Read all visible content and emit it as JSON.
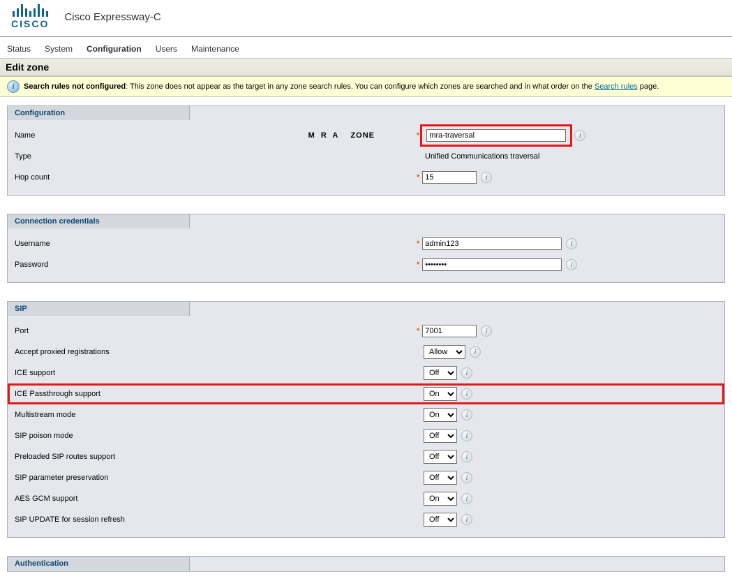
{
  "product": "Cisco Expressway-C",
  "tabs": {
    "status": "Status",
    "system": "System",
    "configuration": "Configuration",
    "users": "Users",
    "maintenance": "Maintenance"
  },
  "page_title": "Edit zone",
  "notify": {
    "strong": "Search rules not configured",
    "text": ": This zone does not appear as the target in any zone search rules. You can configure which zones are searched and in what order on the ",
    "link": "Search rules",
    "tail": " page."
  },
  "section": {
    "configuration": "Configuration",
    "connection": "Connection credentials",
    "sip": "SIP",
    "auth": "Authentication"
  },
  "decor": {
    "mra": "M R A",
    "zone": "ZONE"
  },
  "cfg": {
    "name_label": "Name",
    "name_value": "mra-traversal",
    "type_label": "Type",
    "type_value": "Unified Communications traversal",
    "hop_label": "Hop count",
    "hop_value": "15"
  },
  "conn": {
    "user_label": "Username",
    "user_value": "admin123",
    "pass_label": "Password",
    "pass_value": "••••••••"
  },
  "sip": {
    "port_label": "Port",
    "port_value": "7001",
    "accept_label": "Accept proxied registrations",
    "accept_value": "Allow",
    "ice_label": "ICE support",
    "ice_value": "Off",
    "icep_label": "ICE Passthrough support",
    "icep_value": "On",
    "multi_label": "Multistream mode",
    "multi_value": "On",
    "poison_label": "SIP poison mode",
    "poison_value": "Off",
    "preload_label": "Preloaded SIP routes support",
    "preload_value": "Off",
    "param_label": "SIP parameter preservation",
    "param_value": "Off",
    "aes_label": "AES GCM support",
    "aes_value": "On",
    "update_label": "SIP UPDATE for session refresh",
    "update_value": "Off"
  },
  "opts": {
    "allow": "Allow",
    "on": "On",
    "off": "Off"
  }
}
